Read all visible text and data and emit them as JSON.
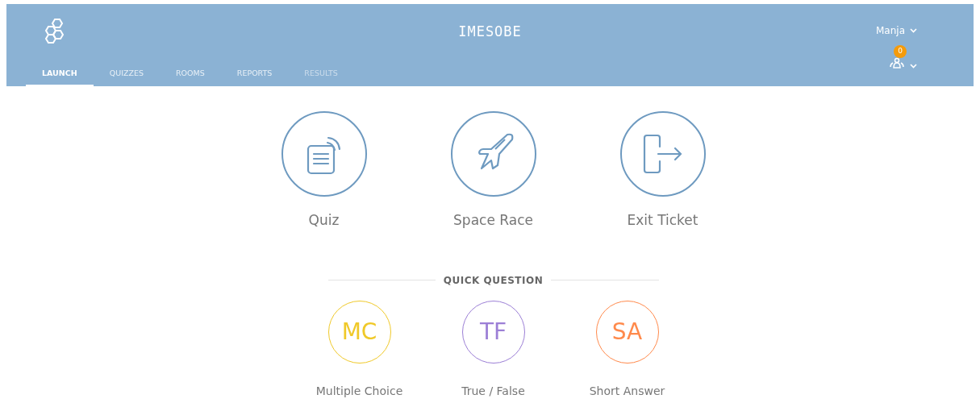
{
  "header": {
    "title": "IMESOBE",
    "user": {
      "name": "Manja"
    },
    "notification_badge": "0"
  },
  "tabs": [
    {
      "label": "LAUNCH",
      "selected": true,
      "disabled": false
    },
    {
      "label": "QUIZZES",
      "selected": false,
      "disabled": false
    },
    {
      "label": "ROOMS",
      "selected": false,
      "disabled": false
    },
    {
      "label": "REPORTS",
      "selected": false,
      "disabled": false
    },
    {
      "label": "RESULTS",
      "selected": false,
      "disabled": true
    }
  ],
  "launch_options": [
    {
      "kind": "quiz",
      "label": "Quiz"
    },
    {
      "kind": "rocket",
      "label": "Space Race"
    },
    {
      "kind": "exit",
      "label": "Exit Ticket"
    }
  ],
  "quick_question": {
    "heading": "QUICK QUESTION",
    "options": [
      {
        "abbr": "MC",
        "label": "Multiple Choice",
        "color": "#f0c929"
      },
      {
        "abbr": "TF",
        "label": "True / False",
        "color": "#9c7fd6"
      },
      {
        "abbr": "SA",
        "label": "Short Answer",
        "color": "#ff8a4c"
      }
    ]
  }
}
